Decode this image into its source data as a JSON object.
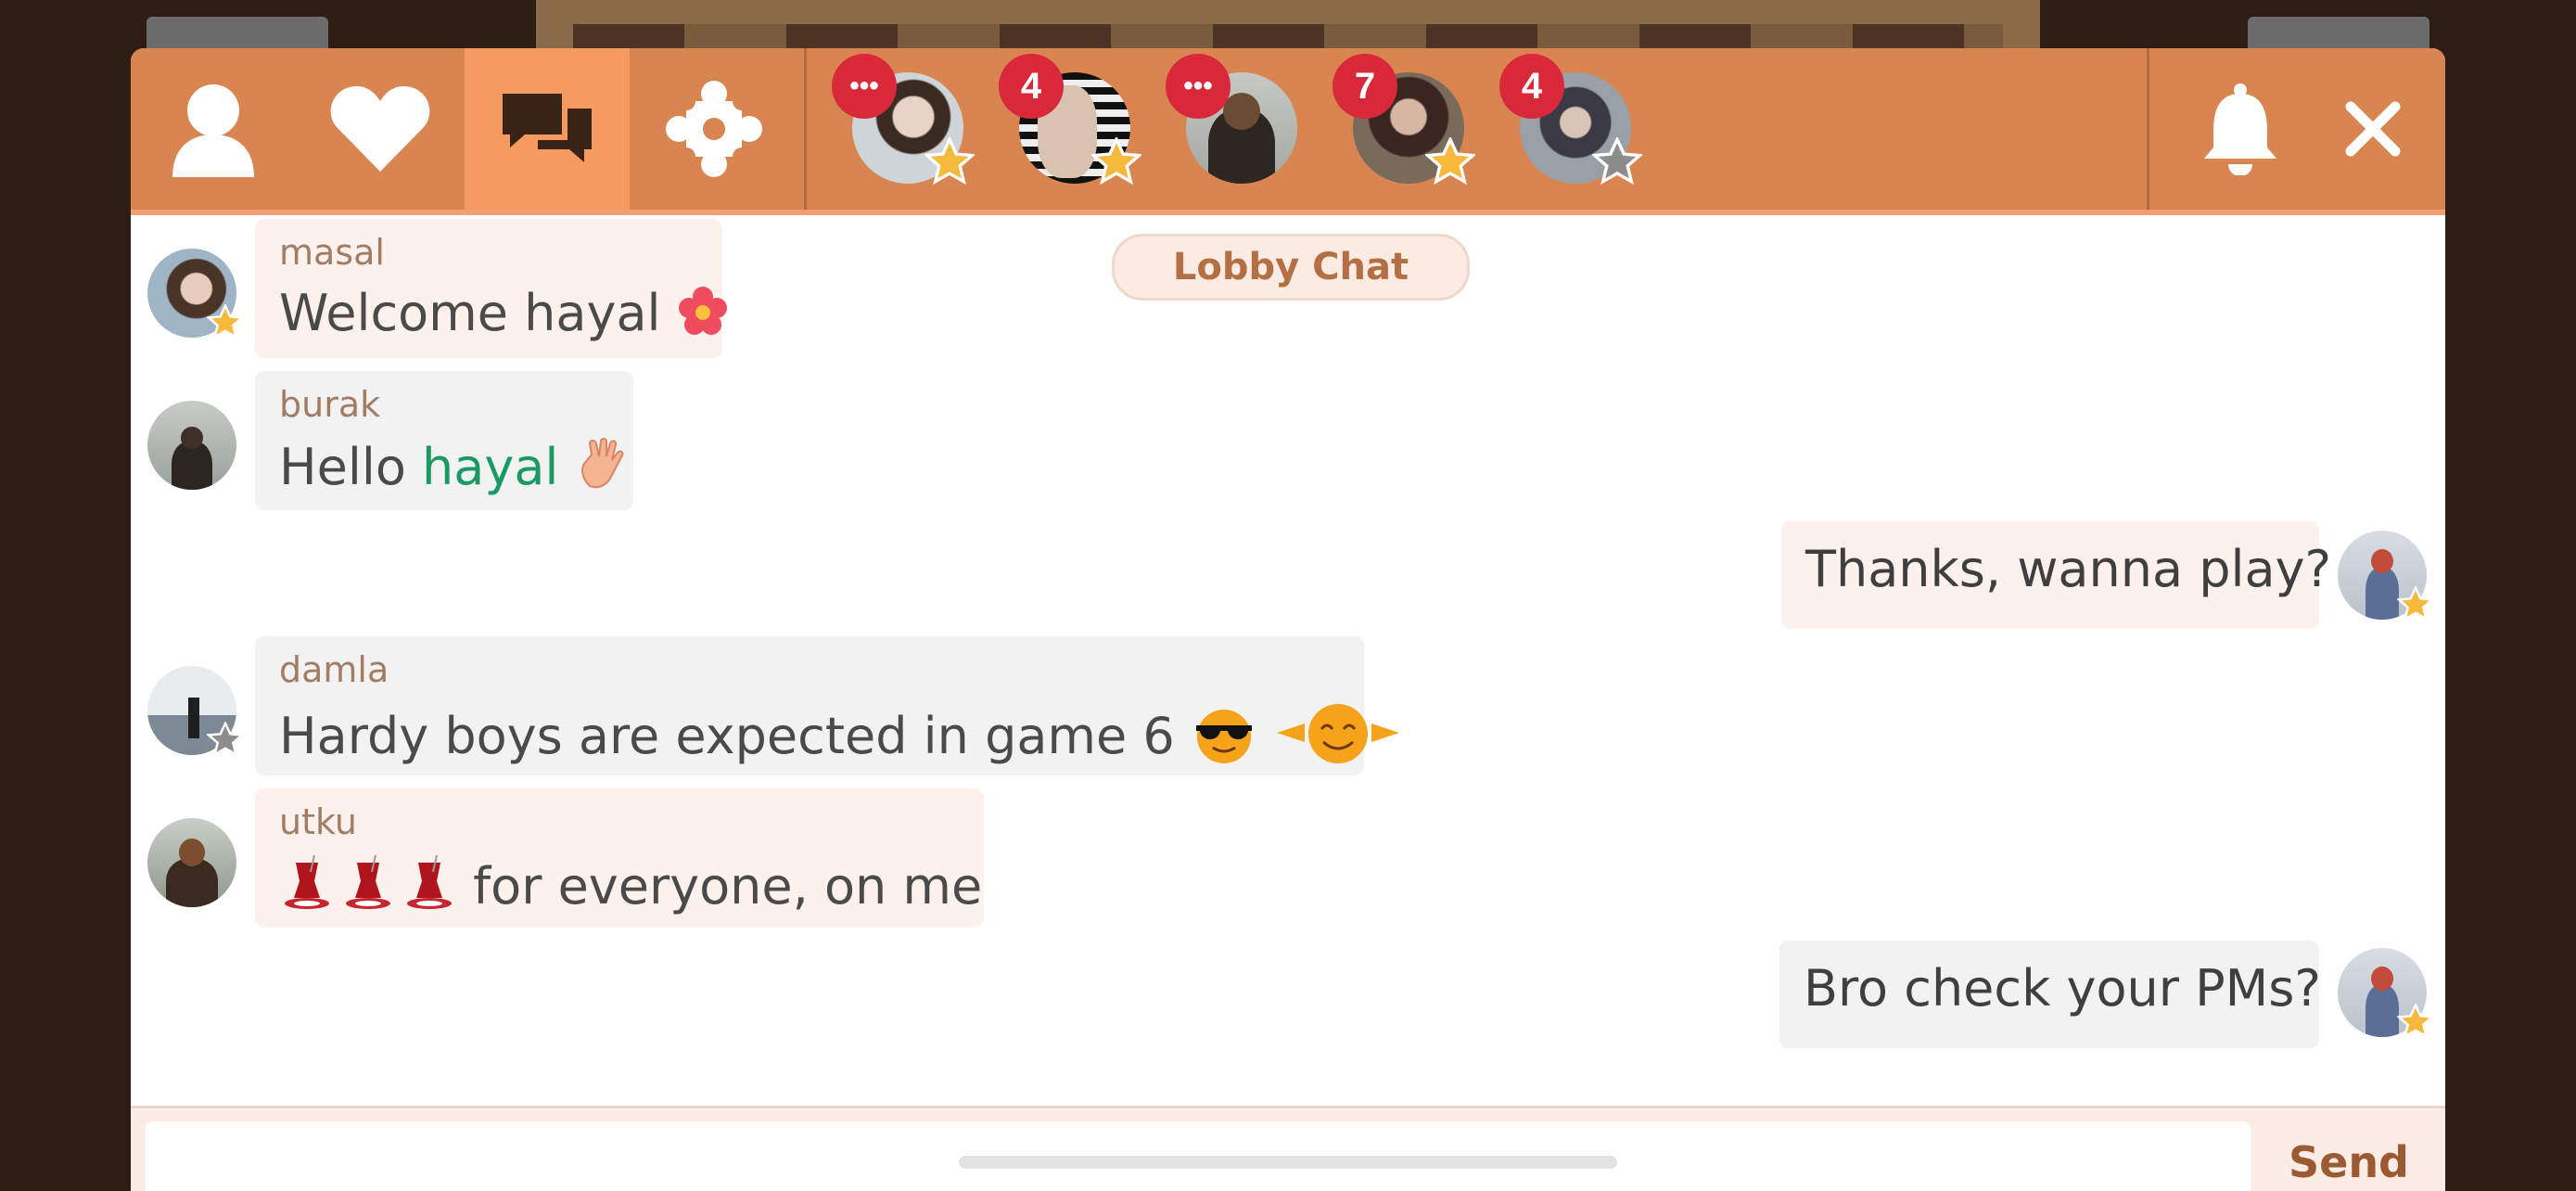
{
  "toolbar": {
    "tabs": [
      {
        "name": "profile",
        "icon": "user-icon",
        "active": false
      },
      {
        "name": "favorites",
        "icon": "heart-icon",
        "active": false
      },
      {
        "name": "chat",
        "icon": "chat-bubbles-icon",
        "active": true
      },
      {
        "name": "games",
        "icon": "puzzle-icon",
        "active": false
      }
    ],
    "conversations": [
      {
        "badge": "•••",
        "star": "gold"
      },
      {
        "badge": "4",
        "star": "gold"
      },
      {
        "badge": "•••",
        "star": "none"
      },
      {
        "badge": "7",
        "star": "gold"
      },
      {
        "badge": "4",
        "star": "gray"
      }
    ],
    "notifications_icon": "bell-icon",
    "close_icon": "close-icon"
  },
  "chat": {
    "room_label": "Lobby Chat",
    "messages": [
      {
        "user": "masal",
        "text": "Welcome hayal",
        "emoji": "flower",
        "star": "gold"
      },
      {
        "user": "burak",
        "text": "Hello ",
        "mention": "hayal",
        "emoji": "wave",
        "star": "none"
      },
      {
        "own": true,
        "text": "Thanks, wanna play?",
        "star": "gold"
      },
      {
        "user": "damla",
        "text": "Hardy boys are expected in game 6",
        "emoji": "sunglasses hug",
        "star": "gray"
      },
      {
        "user": "utku",
        "text": " for everyone, on me",
        "emoji": "tea tea tea",
        "star": "none"
      },
      {
        "own": true,
        "text": "Bro check your PMs?",
        "star": "gold"
      }
    ]
  },
  "composer": {
    "placeholder": "",
    "send_label": "Send"
  },
  "colors": {
    "toolbar": "#d98552",
    "active_tab": "#f59a60",
    "badge": "#d8283a",
    "mention": "#1a9a62",
    "send": "#9c5a33"
  }
}
